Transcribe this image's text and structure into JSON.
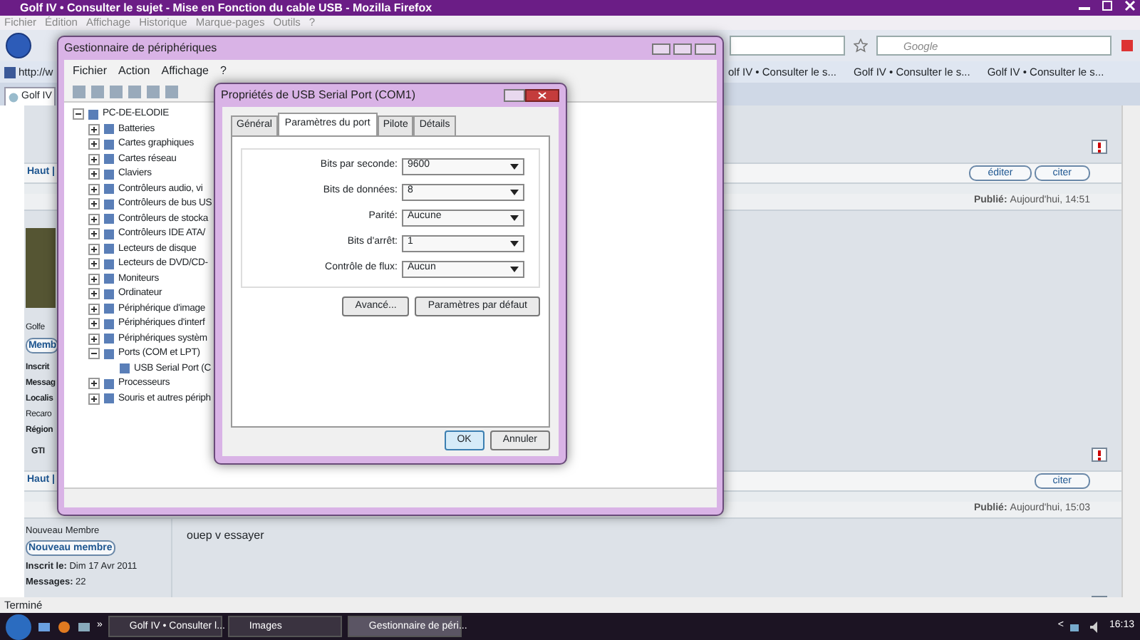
{
  "browser": {
    "title": "Golf IV • Consulter le sujet - Mise en Fonction du cable USB - Mozilla Firefox",
    "menu": [
      "Fichier",
      "Édition",
      "Affichage",
      "Historique",
      "Marque-pages",
      "Outils",
      "?"
    ],
    "search": {
      "placeholder": "Google"
    },
    "bookmarks": [
      "http://w",
      "olf IV • Consulter le s...",
      "Golf IV • Consulter le s...",
      "Golf IV • Consulter le s..."
    ],
    "tabs": [
      {
        "label": "Golf IV",
        "selected": true
      }
    ],
    "status": "Terminé"
  },
  "forum": {
    "posts": [
      {
        "kind": "tail",
        "actions": [
          "éditer",
          "citer"
        ],
        "back": "Haut |"
      },
      {
        "kind": "post",
        "published_label": "Publié:",
        "published": "Aujourd'hui, 14:51",
        "photo": true,
        "name": "Golfe",
        "rank_button": "Memb",
        "info": [
          {
            "kind": "label",
            "text": "Inscrit"
          },
          {
            "kind": "label",
            "text": "Messag"
          },
          {
            "kind": "label",
            "text": "Localis"
          },
          {
            "kind": "text",
            "text": "Recaro"
          },
          {
            "kind": "label",
            "text": "Région"
          }
        ],
        "extra": "GTI",
        "actions": [
          "citer"
        ],
        "back": "Haut |"
      },
      {
        "kind": "post",
        "published_label": "Publié:",
        "published": "Aujourd'hui, 15:03",
        "photo": false,
        "name": "Nouveau Membre",
        "rank_button": "Nouveau membre",
        "info": [
          {
            "kind": "text",
            "text": "**Inscrit le:** Dim 17 Avr 2011"
          },
          {
            "kind": "text",
            "text": "**Messages:** 22"
          }
        ],
        "body": "ouep v essayer"
      }
    ]
  },
  "device_manager": {
    "title": "Gestionnaire de périphériques",
    "menu": [
      "Fichier",
      "Action",
      "Affichage",
      "?"
    ],
    "tree": {
      "label": "PC-DE-ELODIE",
      "expanded": true,
      "children": [
        {
          "label": "Batteries",
          "expanded": false
        },
        {
          "label": "Cartes graphiques",
          "expanded": false
        },
        {
          "label": "Cartes réseau",
          "expanded": false
        },
        {
          "label": "Claviers",
          "expanded": false
        },
        {
          "label": "Contrôleurs audio, vi",
          "expanded": false
        },
        {
          "label": "Contrôleurs de bus US",
          "expanded": false
        },
        {
          "label": "Contrôleurs de stocka",
          "expanded": false
        },
        {
          "label": "Contrôleurs IDE ATA/",
          "expanded": false
        },
        {
          "label": "Lecteurs de disque",
          "expanded": false
        },
        {
          "label": "Lecteurs de DVD/CD-",
          "expanded": false
        },
        {
          "label": "Moniteurs",
          "expanded": false
        },
        {
          "label": "Ordinateur",
          "expanded": false
        },
        {
          "label": "Périphérique d'image",
          "expanded": false
        },
        {
          "label": "Périphériques d'interf",
          "expanded": false
        },
        {
          "label": "Périphériques systèm",
          "expanded": false
        },
        {
          "label": "Ports (COM et LPT)",
          "expanded": true,
          "children": [
            {
              "label": "USB Serial Port (C"
            }
          ]
        },
        {
          "label": "Processeurs",
          "expanded": false
        },
        {
          "label": "Souris et autres périph",
          "expanded": false
        }
      ]
    }
  },
  "dialog": {
    "title": "Propriétés de USB Serial Port (COM1)",
    "tabs": [
      {
        "label": "Général",
        "selected": false
      },
      {
        "label": "Paramètres du port",
        "selected": true
      },
      {
        "label": "Pilote",
        "selected": false
      },
      {
        "label": "Détails",
        "selected": false
      }
    ],
    "fields": [
      {
        "label": "Bits par seconde:",
        "value": "9600"
      },
      {
        "label": "Bits de données:",
        "value": "8"
      },
      {
        "label": "Parité:",
        "value": "Aucune"
      },
      {
        "label": "Bits d'arrêt:",
        "value": "1"
      },
      {
        "label": "Contrôle de flux:",
        "value": "Aucun"
      }
    ],
    "actions": [
      "Avancé...",
      "Paramètres par défaut"
    ],
    "buttons": [
      {
        "label": "OK",
        "default": true
      },
      {
        "label": "Annuler",
        "default": false
      }
    ]
  },
  "taskbar": {
    "items": [
      {
        "label": "Golf IV • Consulter l...",
        "selected": false
      },
      {
        "label": "Images",
        "selected": false
      },
      {
        "label": "Gestionnaire de péri...",
        "selected": true
      }
    ],
    "overflow": "»",
    "tray_arrow": "<",
    "clock": "16:13"
  }
}
